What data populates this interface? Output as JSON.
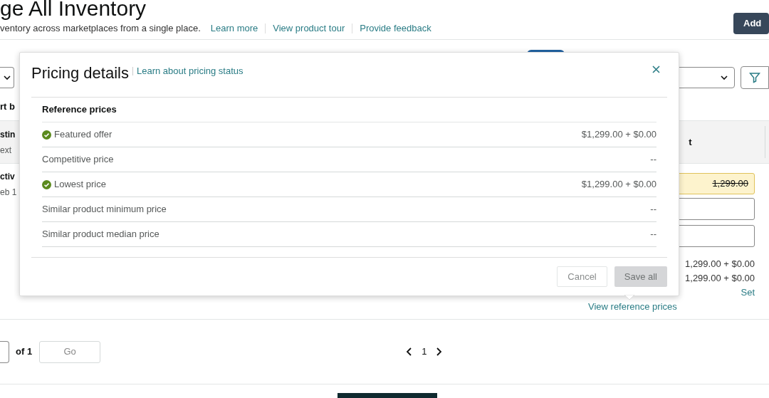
{
  "page": {
    "title": "ge All Inventory",
    "subtitle": "ventory across marketplaces from a single place.",
    "links": [
      "Learn more",
      "View product tour",
      "Provide feedback"
    ],
    "add_button": "Add"
  },
  "toolbar": {
    "sort_label": "rt b"
  },
  "table": {
    "columns": [
      {
        "line1": "stin",
        "line2": "ext"
      },
      {
        "line1": "t"
      }
    ],
    "row": {
      "status": "ctiv",
      "date": "eb 1",
      "price_value": "1,299.00",
      "price_lines": [
        "1,299.00 + $0.00",
        "1,299.00 + $0.00"
      ],
      "set_link": "Set",
      "reference_link": "View reference prices"
    }
  },
  "pagination": {
    "of": "of 1",
    "go": "Go",
    "page": "1"
  },
  "modal": {
    "title": "Pricing details",
    "link": "Learn about pricing status",
    "section": "Reference prices",
    "rows": [
      {
        "label": "Featured offer",
        "value": "$1,299.00 + $0.00",
        "available": true
      },
      {
        "label": "Competitive price",
        "value": "--",
        "available": false
      },
      {
        "label": "Lowest price",
        "value": "$1,299.00 + $0.00",
        "available": true
      },
      {
        "label": "Similar product minimum price",
        "value": "--",
        "available": false
      },
      {
        "label": "Similar product median price",
        "value": "--",
        "available": false
      }
    ],
    "buttons": [
      {
        "label": "Cancel",
        "disabled": false
      },
      {
        "label": "Save all",
        "disabled": true
      }
    ]
  }
}
